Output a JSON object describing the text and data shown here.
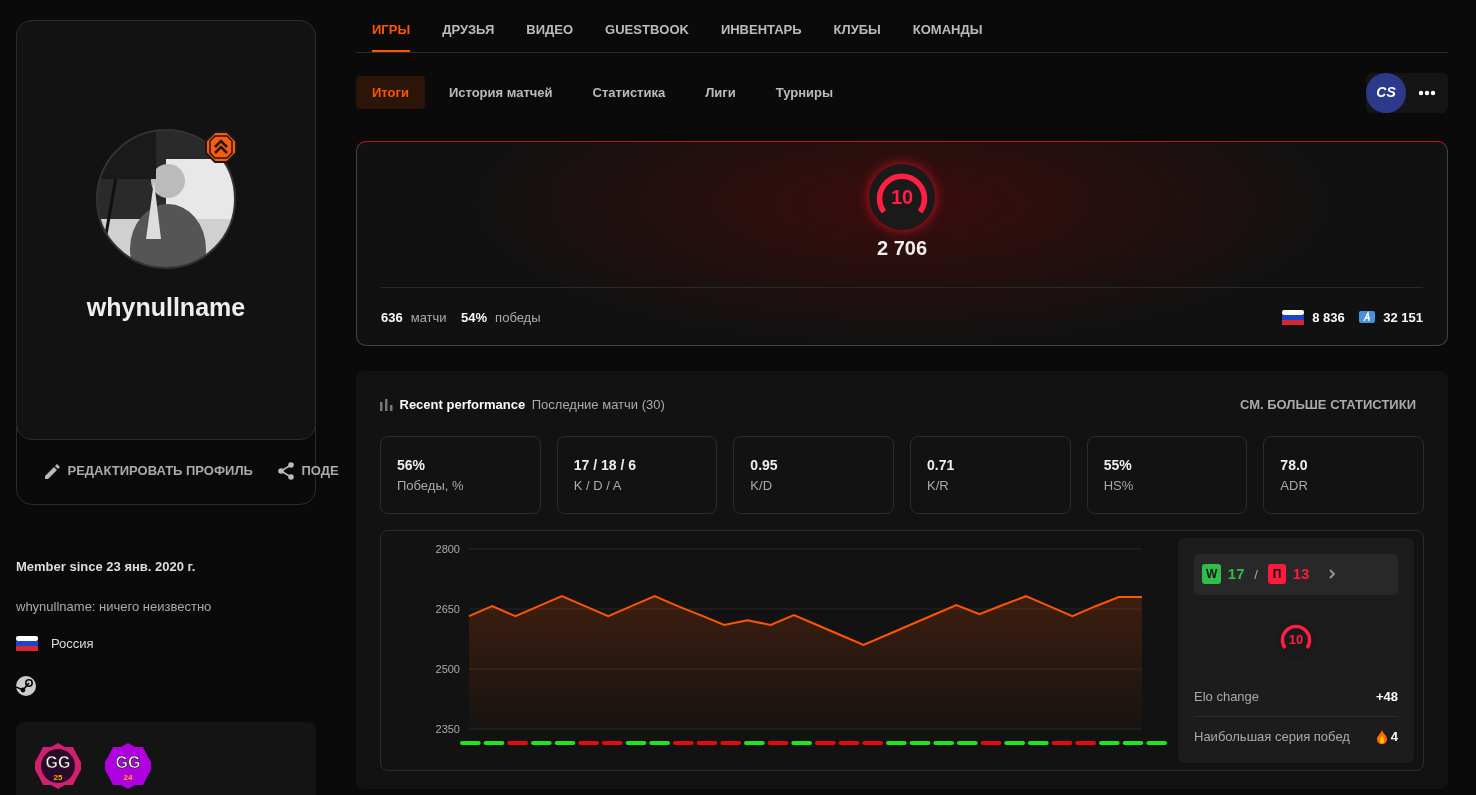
{
  "profile": {
    "username": "whynullname",
    "actions": [
      {
        "kind": "edit",
        "label": "РЕДАКТИРОВАТЬ ПРОФИЛЬ"
      },
      {
        "kind": "share",
        "label": "ПОДЕ"
      }
    ],
    "member_since": "Member since 23 янв. 2020 г.",
    "bio": "whynullname: ничего неизвестно",
    "country": "Россия"
  },
  "badges": [
    {
      "label": "GG",
      "year": "25",
      "color": "#d0206e"
    },
    {
      "label": "GG",
      "year": "24",
      "color": "#b000e0"
    }
  ],
  "tabs": [
    {
      "label": "ИГРЫ",
      "selected": true
    },
    {
      "label": "ДРУЗЬЯ",
      "selected": false
    },
    {
      "label": "ВИДЕО",
      "selected": false
    },
    {
      "label": "GUESTBOOK",
      "selected": false
    },
    {
      "label": "ИНВЕНТАРЬ",
      "selected": false
    },
    {
      "label": "КЛУБЫ",
      "selected": false
    },
    {
      "label": "КОМАНДЫ",
      "selected": false
    }
  ],
  "subtabs": [
    {
      "label": "Итоги",
      "selected": true
    },
    {
      "label": "История матчей",
      "selected": false
    },
    {
      "label": "Статистика",
      "selected": false
    },
    {
      "label": "Лиги",
      "selected": false
    },
    {
      "label": "Турниры",
      "selected": false
    }
  ],
  "game": {
    "logo": "CS"
  },
  "level_card": {
    "level": "10",
    "elo": "2 706",
    "matches": "636",
    "matches_label": "матчи",
    "winrate": "54%",
    "winrate_label": "победы",
    "country_rank": "8 836",
    "region_rank": "32 151"
  },
  "performance": {
    "title": "Recent performance",
    "subtitle": "Последние матчи (30)",
    "more_link": "СМ. БОЛЬШЕ СТАТИСТИКИ",
    "stats": [
      {
        "value": "56%",
        "label": "Победы, %"
      },
      {
        "value": "17 / 18 / 6",
        "label": "K / D / A"
      },
      {
        "value": "0.95",
        "label": "K/D"
      },
      {
        "value": "0.71",
        "label": "K/R"
      },
      {
        "value": "55%",
        "label": "HS%"
      },
      {
        "value": "78.0",
        "label": "ADR"
      }
    ],
    "chart_data": {
      "type": "area",
      "ylim": [
        2350,
        2800
      ],
      "yticks": [
        2350,
        2500,
        2650,
        2800
      ],
      "series": [
        {
          "color": "#ff5500",
          "values": [
            2632,
            2657,
            2632,
            2657,
            2682,
            2657,
            2632,
            2657,
            2682,
            2657,
            2634,
            2610,
            2622,
            2610,
            2635,
            2610,
            2585,
            2560,
            2585,
            2610,
            2635,
            2660,
            2637,
            2660,
            2682,
            2657,
            2632,
            2657,
            2680,
            2680
          ]
        }
      ]
    },
    "match_results": [
      {
        "won": true
      },
      {
        "won": true
      },
      {
        "won": false
      },
      {
        "won": true
      },
      {
        "won": true
      },
      {
        "won": false
      },
      {
        "won": false
      },
      {
        "won": true
      },
      {
        "won": true
      },
      {
        "won": false
      },
      {
        "won": false
      },
      {
        "won": false
      },
      {
        "won": true
      },
      {
        "won": false
      },
      {
        "won": true
      },
      {
        "won": false
      },
      {
        "won": false
      },
      {
        "won": false
      },
      {
        "won": true
      },
      {
        "won": true
      },
      {
        "won": true
      },
      {
        "won": true
      },
      {
        "won": false
      },
      {
        "won": true
      },
      {
        "won": true
      },
      {
        "won": false
      },
      {
        "won": false
      },
      {
        "won": true
      },
      {
        "won": true
      },
      {
        "won": true
      }
    ],
    "summary": {
      "win_tag": "W",
      "wins": "17",
      "separator": "/",
      "loss_tag": "П",
      "losses": "13",
      "level": "10",
      "elo_change_label": "Elo change",
      "elo_change": "+48",
      "streak_label": "Наибольшая серия побед",
      "streak": "4"
    }
  }
}
